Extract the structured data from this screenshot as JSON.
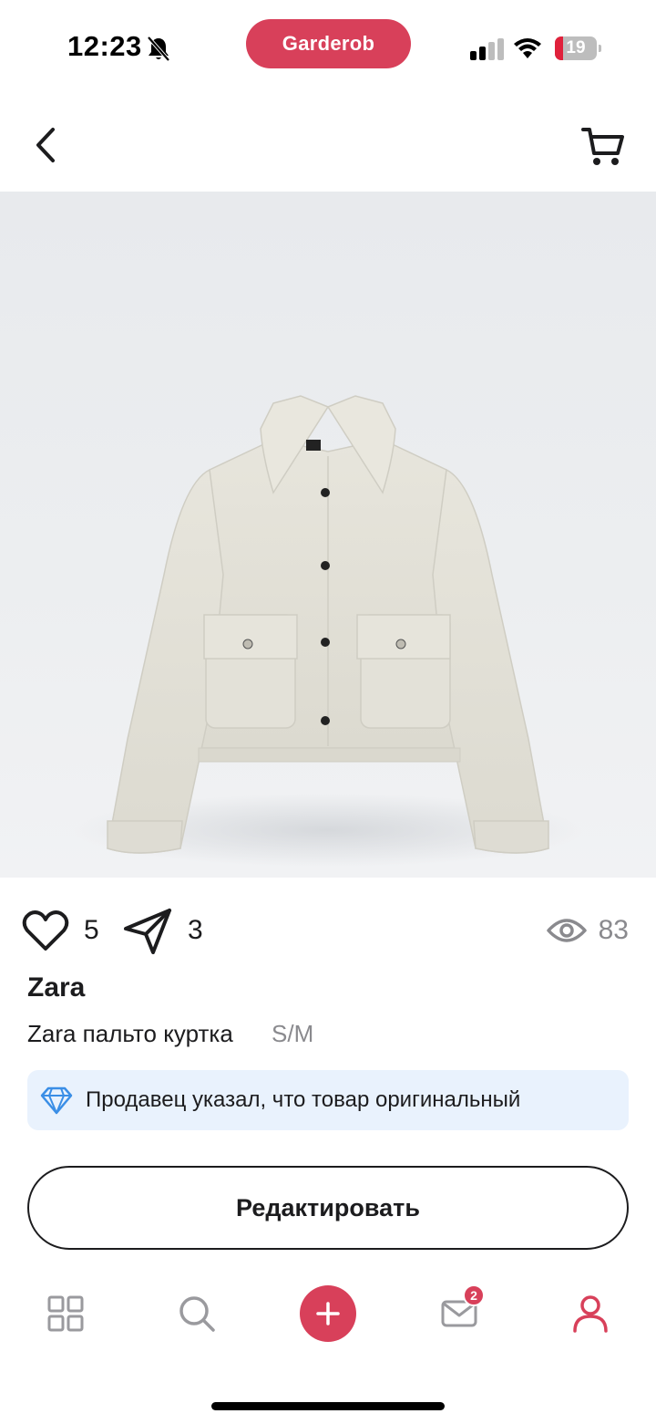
{
  "status_bar": {
    "time": "12:23",
    "app_name": "Garderob",
    "battery_level": "19",
    "battery_fraction": 0.19,
    "icons": [
      "bell-off-icon",
      "signal-icon",
      "wifi-icon",
      "battery-icon"
    ]
  },
  "nav": {
    "back_icon": "chevron-left-icon",
    "cart_icon": "cart-icon"
  },
  "product": {
    "image_subject": "cropped light beige jacket with flap pockets",
    "likes": "5",
    "shares": "3",
    "views": "83",
    "brand": "Zara",
    "title": "Zara пальто куртка",
    "size": "S/M",
    "original_note": "Продавец указал, что товар оригинальный"
  },
  "actions": {
    "edit_label": "Редактировать"
  },
  "tab_bar": {
    "items": [
      "feed-icon",
      "search-icon",
      "add-icon",
      "messages-icon",
      "profile-icon"
    ],
    "messages_badge": "2"
  },
  "colors": {
    "accent": "#d8405a",
    "badge_bg": "#e9f2fd",
    "muted": "#8a8a8e",
    "diamond": "#3a8ee6"
  }
}
